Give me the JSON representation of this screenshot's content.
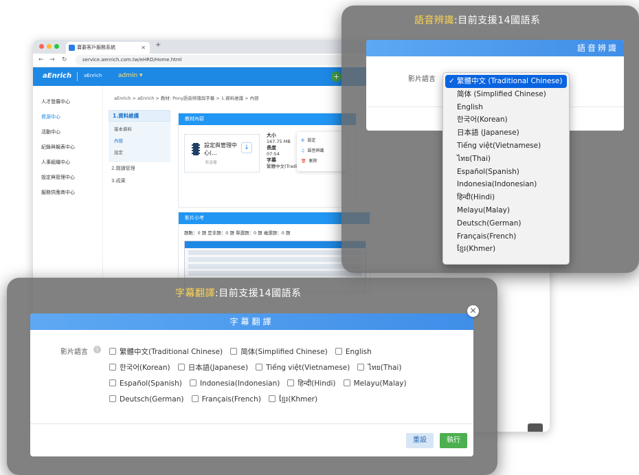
{
  "browser": {
    "tab_title": "寶碁客戶服務系統",
    "url": "service.aenrich.com.tw/eHRD/Home.html"
  },
  "app": {
    "logo": "aEnrich",
    "brand2": "aEnrich",
    "user": "admin ▾"
  },
  "sidebar": {
    "items": [
      {
        "label": "人才發展中心"
      },
      {
        "label": "資源中心"
      },
      {
        "label": "活動中心"
      },
      {
        "label": "紀錄與報表中心"
      },
      {
        "label": "人事組織中心"
      },
      {
        "label": "設定與管理中心"
      },
      {
        "label": "服務供應商中心"
      }
    ]
  },
  "breadcrumb": "aEnrich > aEnrich > 教材: Pony語音辨識與字幕 > 1.資料維護 > 內容",
  "steps": {
    "step1": "1.資料維護",
    "sub": [
      "基本資料",
      "內容",
      "設定"
    ],
    "step2": "2.閱讀管理",
    "step3": "3.成果"
  },
  "content_panel": {
    "title": "教材內容",
    "video_title": "設定與管理中心(...",
    "video_sub": "影音檔",
    "size_label": "大小",
    "size_value": "167.75 MB",
    "length_label": "長度",
    "length_value": "07:54",
    "subtitle_label": "字幕",
    "subtitle_value": "繁體中文(Traditional Chinese)",
    "menu": [
      "設定",
      "語音辨識",
      "刪除"
    ]
  },
  "quiz_panel": {
    "title": "影片小考",
    "line": "題數：0 題  是非題：0 題  單選題：0 題  複選題：0 題"
  },
  "overlay1": {
    "title_highlight": "語音辨識",
    "title_rest": ":目前支援14國語系",
    "dialog_title": "語音辨識",
    "field_label": "影片語言",
    "options": [
      "繁體中文 (Traditional Chinese)",
      "简体 (Simplified Chinese)",
      "English",
      "한국어(Korean)",
      "日本語 (Japanese)",
      "Tiếng việt(Vietnamese)",
      "ไทย(Thai)",
      "Español(Spanish)",
      "Indonesia(Indonesian)",
      "हिन्दी(Hindi)",
      "Melayu(Malay)",
      "Deutsch(German)",
      "Français(French)",
      "ខ្មែរ(Khmer)"
    ]
  },
  "overlay2": {
    "title_highlight": "字幕翻譯",
    "title_rest": ":目前支援14國語系",
    "dialog_title": "字幕翻譯",
    "field_label": "影片語言",
    "checkboxes": [
      "繁體中文(Traditional Chinese)",
      "简体(Simplified Chinese)",
      "English",
      "한국어(Korean)",
      "日本語(Japanese)",
      "Tiếng việt(Vietnamese)",
      "ไทย(Thai)",
      "Español(Spanish)",
      "Indonesia(Indonesian)",
      "हिन्दी(Hindi)",
      "Melayu(Malay)",
      "Deutsch(German)",
      "Français(French)",
      "ខ្មែរ(Khmer)"
    ],
    "reset_label": "重設",
    "run_label": "執行"
  },
  "colors": {
    "accent": "#1e88e5",
    "highlight": "#ffd54f",
    "run": "#4caf50"
  }
}
